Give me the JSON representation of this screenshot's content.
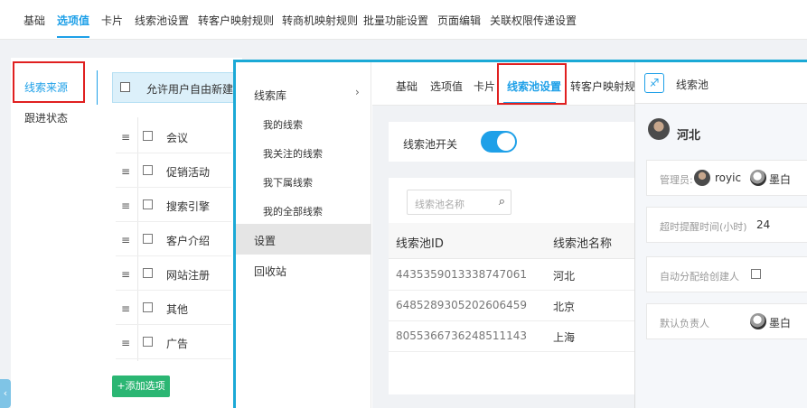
{
  "top_tabs": [
    "基础",
    "选项值",
    "卡片",
    "线索池设置",
    "转客户映射规则",
    "转商机映射规则",
    "批量功能设置",
    "页面编辑",
    "关联权限传递设置"
  ],
  "left_menu": {
    "items": [
      "线索来源",
      "跟进状态"
    ]
  },
  "options": {
    "allow_label": "允许用户自由新建",
    "rows": [
      "会议",
      "促销活动",
      "搜索引擎",
      "客户介绍",
      "网站注册",
      "其他",
      "广告"
    ],
    "drag_icon": "≡",
    "add_button": "+添加选项"
  },
  "edge_tab": "‹",
  "lead_menu": {
    "root": "线索库",
    "chevron": "›",
    "subs": [
      "我的线索",
      "我关注的线索",
      "我下属线索",
      "我的全部线索"
    ],
    "settings": "设置",
    "recycle": "回收站"
  },
  "inner_tabs": [
    "基础",
    "选项值",
    "卡片",
    "线索池设置",
    "转客户映射规则"
  ],
  "pool": {
    "switch_label": "线索池开关",
    "search_placeholder": "线索池名称",
    "search_icon": "⌕",
    "headers": [
      "线索池ID",
      "线索池名称"
    ],
    "rows": [
      {
        "id": "4435359013338747061",
        "name": "河北"
      },
      {
        "id": "6485289305202606459",
        "name": "北京"
      },
      {
        "id": "8055366736248511143",
        "name": "上海"
      }
    ]
  },
  "detail": {
    "title": "线索池",
    "icon_glyph": "♐",
    "name": "河北",
    "admin_label": "管理员:",
    "admins": [
      "royic",
      "墨白"
    ],
    "timeout_label": "超时提醒时间(小时)",
    "timeout_value": "24",
    "auto_label": "自动分配给创建人",
    "owner_label": "默认负责人",
    "owner": "墨白"
  },
  "colors": {
    "accent": "#1ea0e8",
    "highlight_box": "#e02020",
    "overlay_border": "#1ba9d6",
    "add_button": "#2bb673"
  }
}
